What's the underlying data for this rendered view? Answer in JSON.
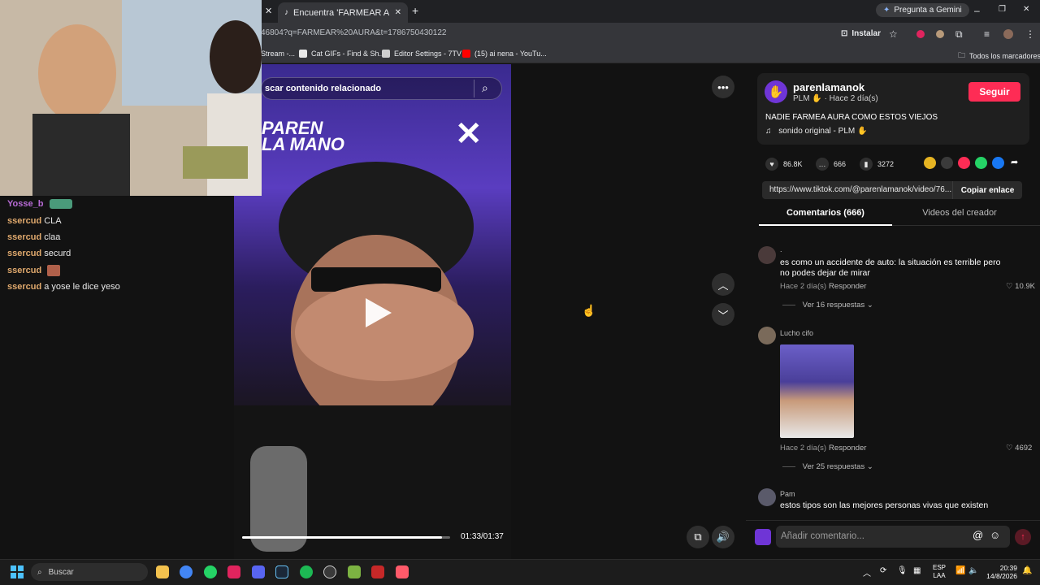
{
  "browser": {
    "tab_title": "Encuentra 'FARMEAR AURA' en",
    "url": "46804?q=FARMEAR%20AURA&t=1786750430122",
    "gemini_label": "Pregunta a Gemini",
    "install_label": "Instalar",
    "bookmarks": [
      {
        "label": "Stream -...",
        "color": "#9146ff"
      },
      {
        "label": "Cat GIFs - Find & Sh...",
        "color": "#e8e8e8"
      },
      {
        "label": "Editor Settings - 7TV",
        "color": "#cfcfcf"
      },
      {
        "label": "(15) ai nena - YouTu...",
        "color": "#ff0000"
      }
    ],
    "all_bookmarks": "Todos los marcadores"
  },
  "chat": {
    "lines": [
      {
        "user": "Yosse_b",
        "msg": "",
        "user_color": "#b86bd6"
      },
      {
        "user": "ssercud",
        "msg": "CLA",
        "user_color": "#e0a96d"
      },
      {
        "user": "ssercud",
        "msg": "claa",
        "user_color": "#e0a96d"
      },
      {
        "user": "ssercud",
        "msg": "securd",
        "user_color": "#e0a96d"
      },
      {
        "user": "ssercud",
        "msg": "",
        "user_color": "#e0a96d"
      },
      {
        "user": "ssercud",
        "msg": "a yose le dice yeso",
        "user_color": "#e0a96d"
      }
    ]
  },
  "video": {
    "search_placeholder": "scar contenido relacionado",
    "timecode": "01:33/01:37",
    "progress": 0.96
  },
  "creator": {
    "name": "parenlamanok",
    "sub": "PLM ✋ · Hace 2 día(s)",
    "follow_label": "Seguir",
    "description": "NADIE FARMEA AURA COMO ESTOS VIEJOS",
    "sound": "sonido original - PLM ✋"
  },
  "stats": {
    "likes": "86.8K",
    "comments": "666",
    "saves": "3272"
  },
  "share": {
    "link": "https://www.tiktok.com/@parenlamanok/video/76...",
    "copy_label": "Copiar enlace"
  },
  "tabs": {
    "comments": "Comentarios (666)",
    "videos": "Videos del creador"
  },
  "comments": [
    {
      "user": ".",
      "text": "es como un accidente de auto: la situación es terrible pero no podes dejar de mirar",
      "time": "Hace 2 día(s)",
      "reply": "Responder",
      "likes": "10.9K",
      "more": "Ver 16 respuestas"
    },
    {
      "user": "Lucho cifo",
      "text": "",
      "time": "Hace 2 día(s)",
      "reply": "Responder",
      "likes": "4692",
      "more": "Ver 25 respuestas"
    },
    {
      "user": "Pam",
      "text": "estos tipos son las mejores personas vivas que existen"
    }
  ],
  "comment_input_placeholder": "Añadir comentario...",
  "taskbar": {
    "search_label": "Buscar",
    "lang": "ESP",
    "lang2": "LAA",
    "time": "20:39",
    "date": "14/8/2026"
  }
}
